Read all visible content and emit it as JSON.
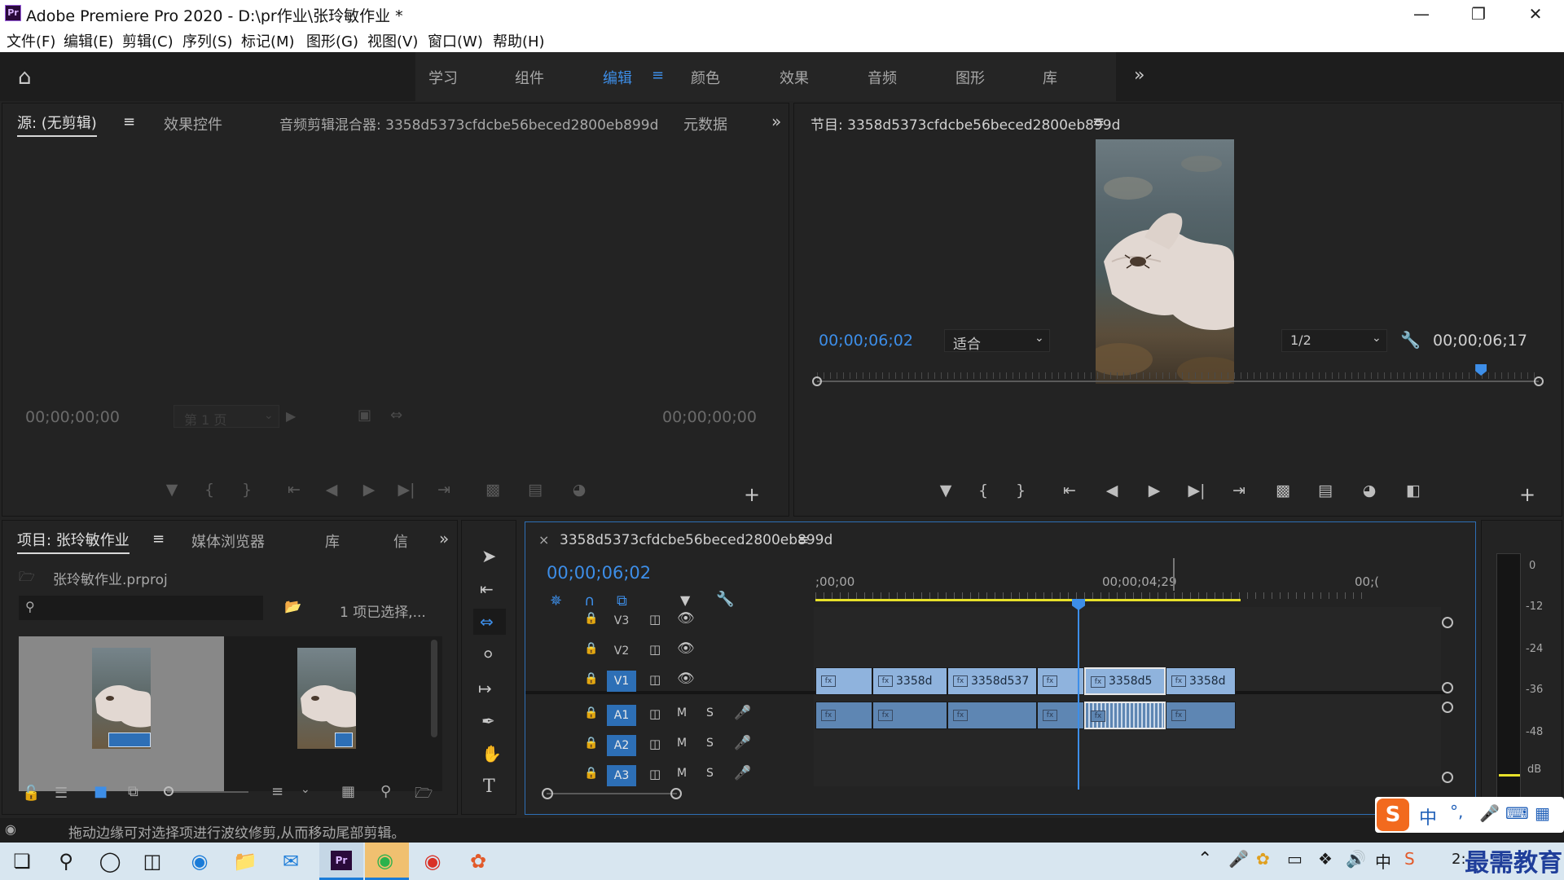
{
  "window": {
    "title": "Adobe Premiere Pro 2020 - D:\\pr作业\\张玲敏作业 *",
    "app_icon": "Pr",
    "controls": [
      "minimize-icon",
      "restore-icon",
      "close-icon"
    ]
  },
  "menu": [
    "文件(F)",
    "编辑(E)",
    "剪辑(C)",
    "序列(S)",
    "标记(M)",
    "图形(G)",
    "视图(V)",
    "窗口(W)",
    "帮助(H)"
  ],
  "workspaces": {
    "tabs": [
      "学习",
      "组件",
      "编辑",
      "颜色",
      "效果",
      "音频",
      "图形",
      "库"
    ],
    "active": "编辑",
    "overflow": "»"
  },
  "source_panel": {
    "tabs": [
      "源: (无剪辑)",
      "效果控件",
      "音频剪辑混合器: 3358d5373cfdcbe56beced2800eb899d",
      "元数据"
    ],
    "timecode_in": "00;00;00;00",
    "page": "第 1 页",
    "timecode_out": "00;00;00;00"
  },
  "program_panel": {
    "title": "节目: 3358d5373cfdcbe56beced2800eb899d",
    "timecode": "00;00;06;02",
    "fit": "适合",
    "resolution": "1/2",
    "duration": "00;00;06;17",
    "playhead_fraction": 0.92
  },
  "project_panel": {
    "tabs": [
      "项目: 张玲敏作业",
      "媒体浏览器",
      "库",
      "信"
    ],
    "file": "张玲敏作业.prproj",
    "selection": "1 项已选择,..."
  },
  "timeline": {
    "sequence": "3358d5373cfdcbe56beced2800eb899d",
    "timecode": "00;00;06;02",
    "ruler": [
      ";00;00",
      "00;00;04;29",
      "00;("
    ],
    "tracks": [
      {
        "name": "V3",
        "type": "video",
        "on": false
      },
      {
        "name": "V2",
        "type": "video",
        "on": false
      },
      {
        "name": "V1",
        "type": "video",
        "on": true
      },
      {
        "name": "A1",
        "type": "audio",
        "on": true
      },
      {
        "name": "A2",
        "type": "audio",
        "on": true
      },
      {
        "name": "A3",
        "type": "audio",
        "on": true
      }
    ],
    "audio_buttons": [
      "M",
      "S"
    ],
    "video_clips": [
      "",
      "3358d",
      "3358d537",
      "",
      "3358d5",
      "3358d"
    ],
    "fx_label": "fx"
  },
  "meter": {
    "scale": [
      "0",
      "-12",
      "-24",
      "-36",
      "-48",
      "dB"
    ]
  },
  "status": {
    "message": "拖动边缘可对选择项进行波纹修剪,从而移动尾部剪辑。"
  },
  "ime": {
    "items": [
      "中",
      "°,",
      "mic-icon",
      "keyboard-icon",
      "grid-icon"
    ]
  },
  "taskbar": {
    "tray": [
      "中"
    ],
    "clock": "2:"
  },
  "watermark": "最需教育"
}
